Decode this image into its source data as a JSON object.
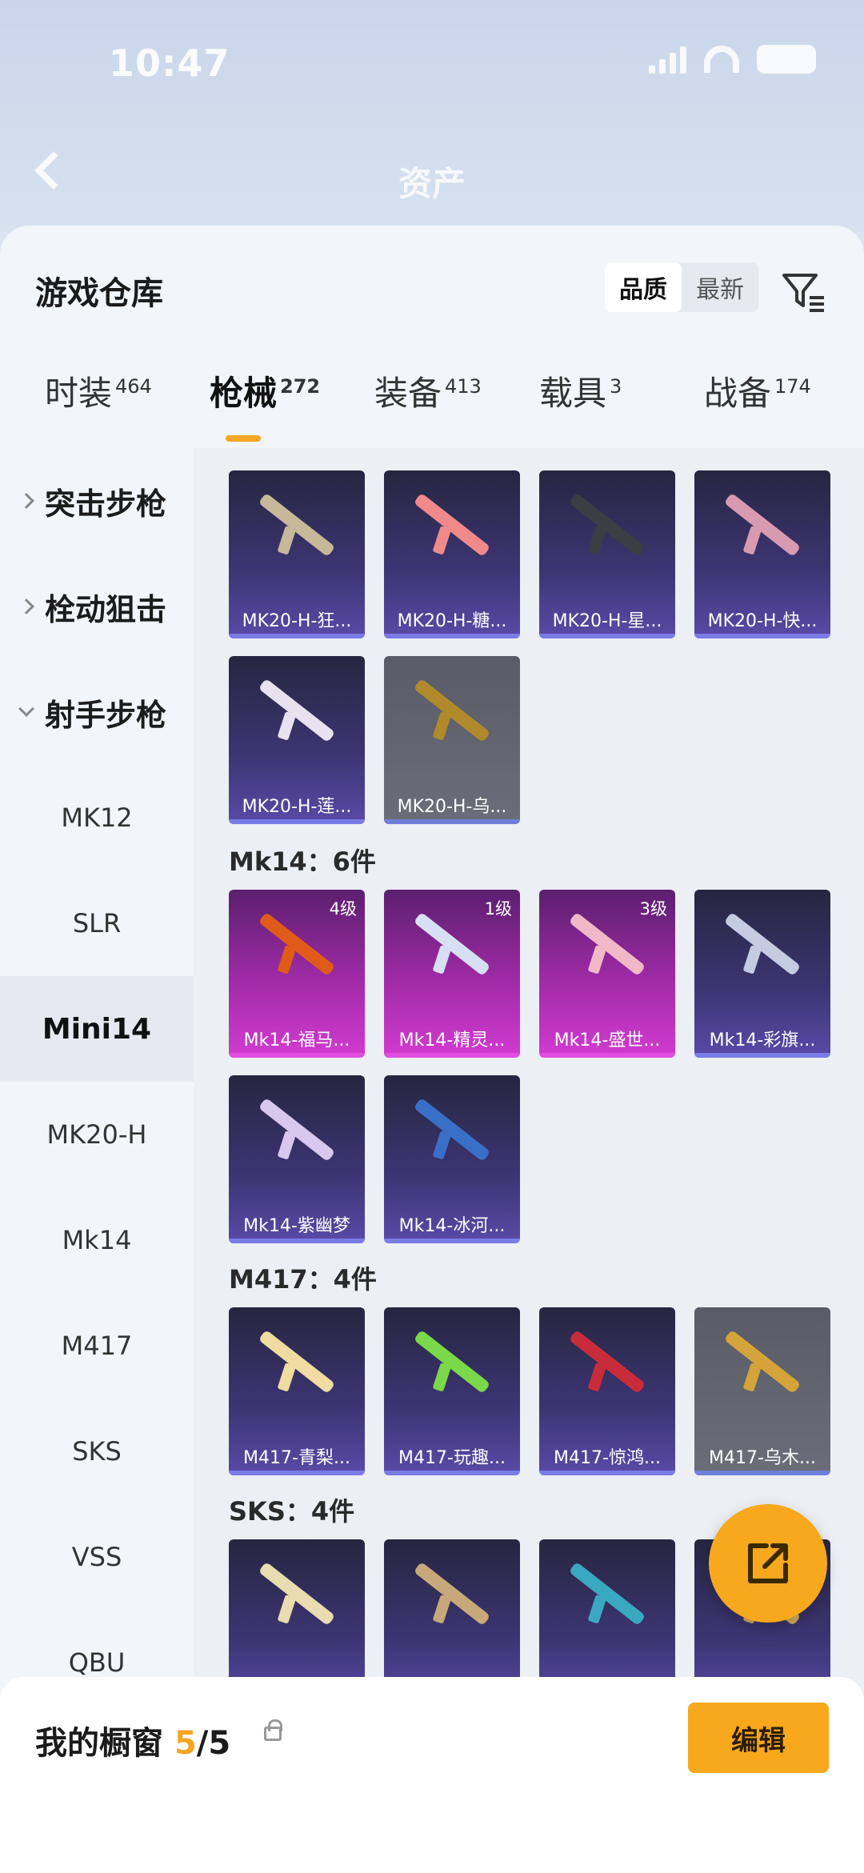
{
  "status_bar": {
    "time": "10:47"
  },
  "header": {
    "title": "资产"
  },
  "sheet": {
    "title": "游戏仓库",
    "sort_options": [
      "品质",
      "最新"
    ],
    "sort_active": "品质"
  },
  "tabs": [
    {
      "label": "时装",
      "count": "464"
    },
    {
      "label": "枪械",
      "count": "272"
    },
    {
      "label": "装备",
      "count": "413"
    },
    {
      "label": "载具",
      "count": "3"
    },
    {
      "label": "战备",
      "count": "174"
    }
  ],
  "sidebar": {
    "items": [
      {
        "label": "突击步枪"
      },
      {
        "label": "栓动狙击"
      },
      {
        "label": "射手步枪"
      },
      {
        "label": "MK12"
      },
      {
        "label": "SLR"
      },
      {
        "label": "Mini14"
      },
      {
        "label": "MK20-H"
      },
      {
        "label": "Mk14"
      },
      {
        "label": "M417"
      },
      {
        "label": "SKS"
      },
      {
        "label": "VSS"
      },
      {
        "label": "QBU"
      }
    ],
    "selected": "Mini14"
  },
  "sections": {
    "mk20": {
      "items": [
        {
          "name": "MK20-H-狂...",
          "color": "#c8b89a"
        },
        {
          "name": "MK20-H-糖...",
          "color": "#f08a8a"
        },
        {
          "name": "MK20-H-星...",
          "color": "#3d3d44"
        },
        {
          "name": "MK20-H-快...",
          "color": "#d89ab0"
        },
        {
          "name": "MK20-H-莲...",
          "color": "#e8e2f0"
        },
        {
          "name": "MK20-H-乌...",
          "color": "#b08a2a"
        }
      ]
    },
    "mk14": {
      "title": "Mk14：6件",
      "items": [
        {
          "name": "Mk14-福马...",
          "level": "4级",
          "color": "#e05a1a"
        },
        {
          "name": "Mk14-精灵...",
          "level": "1级",
          "color": "#d7dff5"
        },
        {
          "name": "Mk14-盛世...",
          "level": "3级",
          "color": "#f1b8c8"
        },
        {
          "name": "Mk14-彩旗...",
          "level": "",
          "color": "#c5cbe0"
        },
        {
          "name": "Mk14-紫幽梦",
          "level": "",
          "color": "#d8c8ee"
        },
        {
          "name": "Mk14-冰河...",
          "level": "",
          "color": "#3a6fc8"
        }
      ]
    },
    "m417": {
      "title": "M417：4件",
      "items": [
        {
          "name": "M417-青梨...",
          "color": "#f0dca0"
        },
        {
          "name": "M417-玩趣...",
          "color": "#7ad84a"
        },
        {
          "name": "M417-惊鸿...",
          "color": "#c82c3a"
        },
        {
          "name": "M417-乌木...",
          "color": "#d4a43a"
        }
      ]
    },
    "sks": {
      "title": "SKS：4件",
      "items": [
        {
          "color": "#e8dcb0"
        },
        {
          "color": "#c8a87a"
        },
        {
          "color": "#3aa8c0"
        },
        {
          "color": "#d4a85a"
        }
      ]
    }
  },
  "bottom_bar": {
    "label": "我的橱窗",
    "current": "5",
    "total": "/5",
    "edit_label": "编辑"
  },
  "colors": {
    "accent": "#f7a81c",
    "card_purple": "#3d3574",
    "card_pink": "#a12ba8"
  }
}
